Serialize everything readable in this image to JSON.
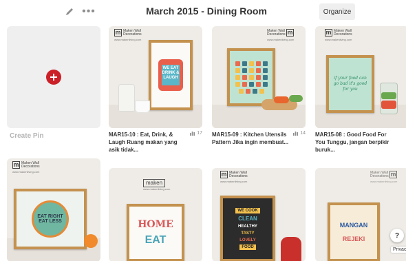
{
  "header": {
    "board_title": "March 2015 - Dining Room",
    "organize_label": "Organize",
    "more_label": "•••",
    "icons": [
      "pencil-icon",
      "more-icon"
    ]
  },
  "create_pin": {
    "label": "Create Pin",
    "icon": "plus-icon",
    "accent": "#cb2027"
  },
  "pins": [
    {
      "brand": "Maken Wall Decorations",
      "brand_url": "www.makenliving.com",
      "art_text": "WE EAT DRINK & LAUGH",
      "description": "MAR15-10 : Eat, Drink, & Laugh Ruang makan yang asik tidak...",
      "count": "17"
    },
    {
      "brand": "Maken Wall Decorations",
      "brand_url": "www.makenliving.com",
      "description": "MAR15-09 : Kitchen Utensils Pattern Jika ingin membuat...",
      "count": "14"
    },
    {
      "brand": "Maken Wall Decorations",
      "brand_url": "www.makenliving.com",
      "art_text": "if your food can go bad it's good for you",
      "description": "MAR15-08 : Good Food For You Tunggu, jangan berpikir buruk...",
      "count": ""
    }
  ],
  "pins_row2": [
    {
      "brand": "Maken Wall Decorations",
      "brand_url": "www.makenliving.com",
      "art_text": "EAT RIGHT EAT LESS"
    },
    {
      "brand": "maken",
      "brand_url": "www.makenliving.com",
      "art_text_1": "HOME",
      "art_text_2": "EAT"
    },
    {
      "brand": "Maken Wall Decorations",
      "brand_url": "www.makenliving.com",
      "art_lines": [
        "WE COOK",
        "CLEAN",
        "HEALTHY",
        "TASTY",
        "LOVELY",
        "FOOD"
      ]
    },
    {
      "brand": "Maken Wall Decorations",
      "brand_url": "www.makenliving.com",
      "art_lines": [
        "MANGAN",
        "REJEKI"
      ]
    }
  ],
  "footer": {
    "help_label": "?",
    "privacy_label": "Privac"
  }
}
